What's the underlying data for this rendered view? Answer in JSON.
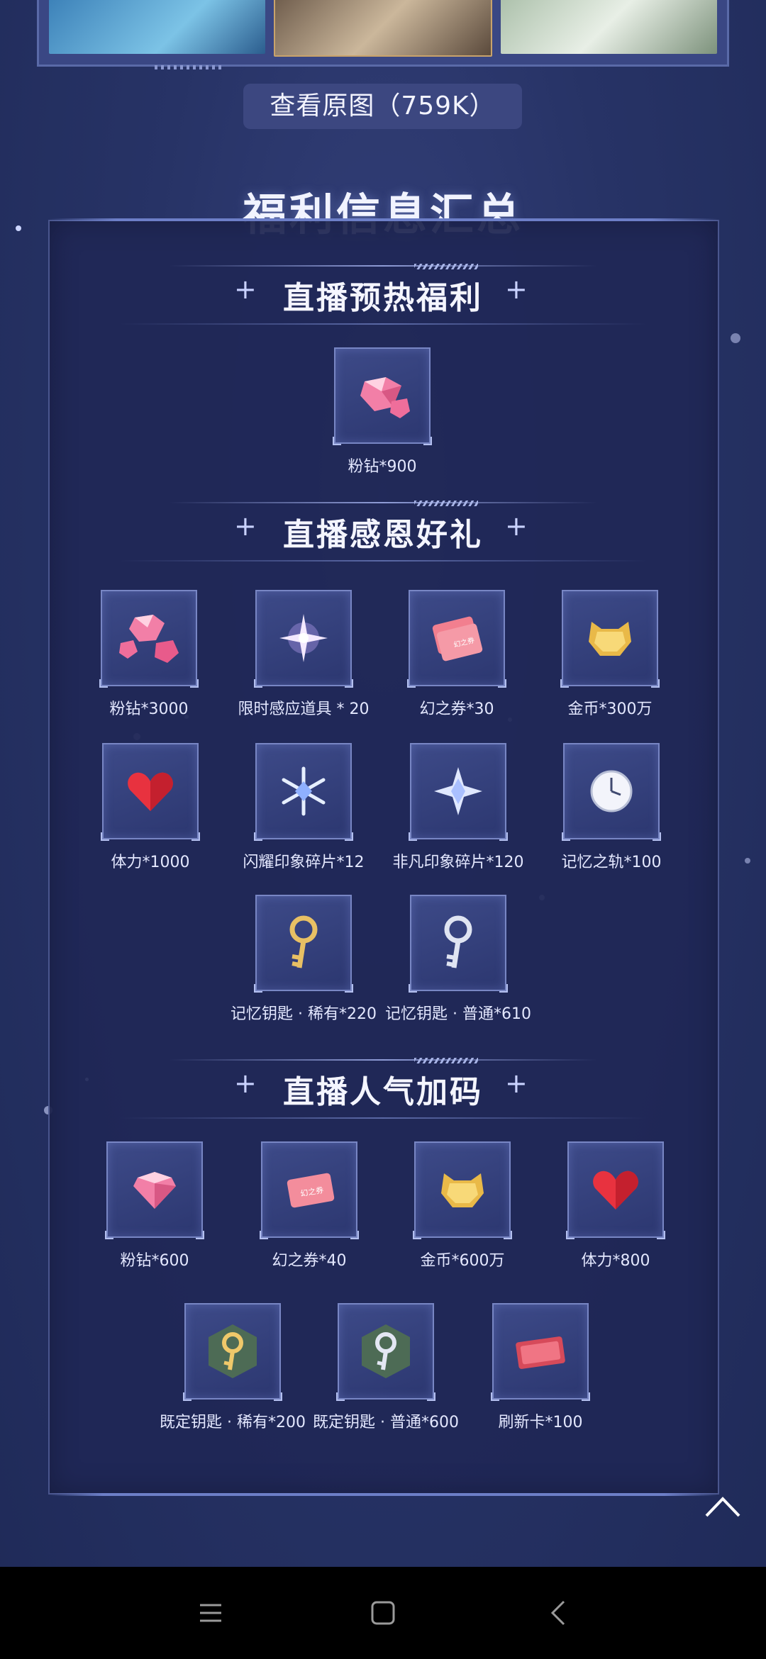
{
  "view_original_label": "查看原图（759K）",
  "main_title": "福利信息汇总",
  "sections": [
    {
      "title": "直播预热福利",
      "items": [
        {
          "label": "粉钻*900",
          "icon": "pink-diamond-icon"
        }
      ]
    },
    {
      "title": "直播感恩好礼",
      "items": [
        {
          "label": "粉钻*3000",
          "icon": "pink-diamonds-icon"
        },
        {
          "label": "限时感应道具 * 20",
          "icon": "sparkle-star-icon"
        },
        {
          "label": "幻之券*30",
          "icon": "ticket-icon"
        },
        {
          "label": "金币*300万",
          "icon": "gold-coin-cat-icon"
        },
        {
          "label": "体力*1000",
          "icon": "heart-icon"
        },
        {
          "label": "闪耀印象碎片*12",
          "icon": "snowflake-crystal-icon"
        },
        {
          "label": "非凡印象碎片*120",
          "icon": "star-crystal-icon"
        },
        {
          "label": "记忆之轨*100",
          "icon": "clock-icon"
        },
        {
          "label": "记忆钥匙 · 稀有*220",
          "icon": "gold-key-icon"
        },
        {
          "label": "记忆钥匙 · 普通*610",
          "icon": "silver-key-icon"
        }
      ]
    },
    {
      "title": "直播人气加码",
      "items": [
        {
          "label": "粉钻*600",
          "icon": "pink-diamond-icon"
        },
        {
          "label": "幻之券*40",
          "icon": "ticket-icon"
        },
        {
          "label": "金币*600万",
          "icon": "gold-coin-cat-icon"
        },
        {
          "label": "体力*800",
          "icon": "heart-icon"
        },
        {
          "label": "既定钥匙 · 稀有*200",
          "icon": "gold-key-hexagon-icon"
        },
        {
          "label": "既定钥匙 · 普通*600",
          "icon": "silver-key-hexagon-icon"
        },
        {
          "label": "刷新卡*100",
          "icon": "refresh-card-icon"
        }
      ]
    }
  ],
  "colors": {
    "background": "#273366",
    "panel": "#1f2756",
    "accent": "#7886c4"
  }
}
